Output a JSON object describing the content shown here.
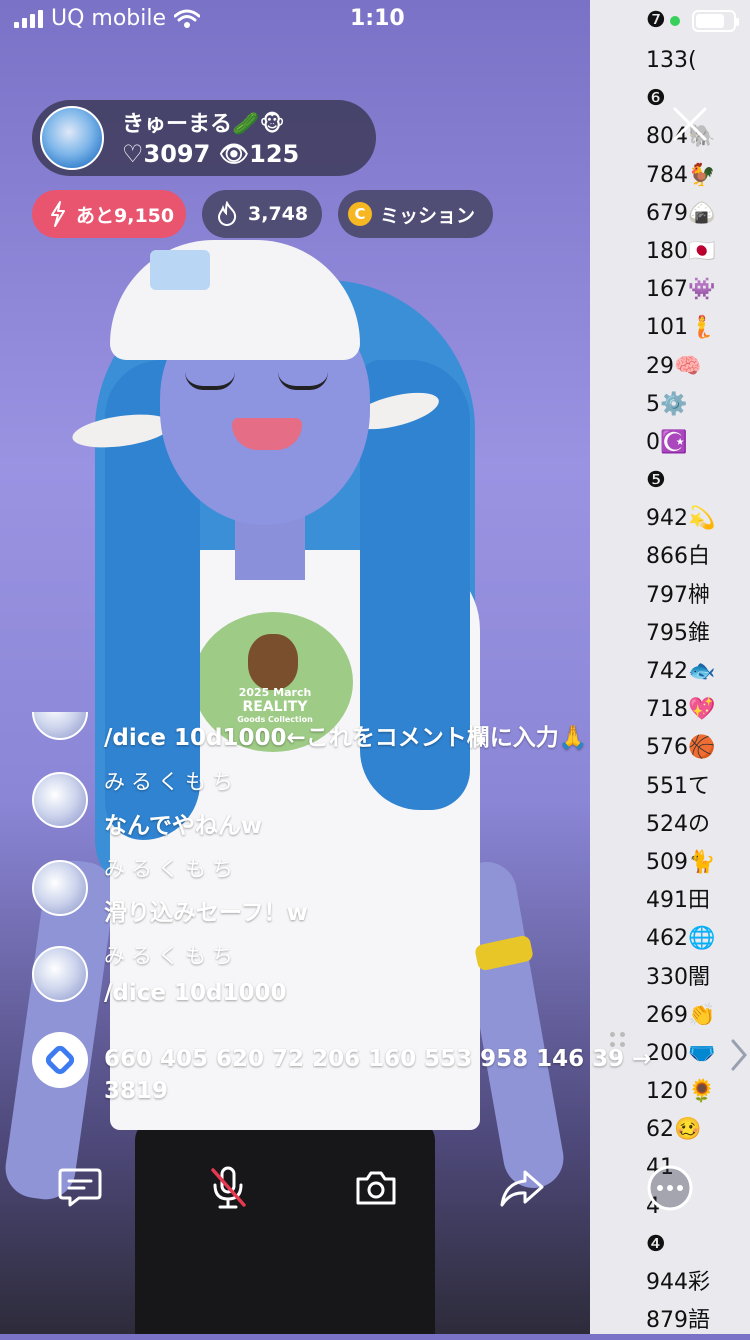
{
  "status_bar": {
    "carrier": "UQ mobile",
    "time": "1:10"
  },
  "streamer": {
    "name": "きゅーまる🥒🐵",
    "stats": "♡3097 👁125"
  },
  "pills": {
    "boost": "あと9,150",
    "fire": "3,748",
    "mission_coin": "C",
    "mission": "ミッション"
  },
  "comments": {
    "partial": "/dice 10d1000←これをコメント欄に入力🙏",
    "items": [
      {
        "name": "みるくもち",
        "text": "なんでやねんw"
      },
      {
        "name": "みるくもち",
        "text": "滑り込みセーフ！w"
      },
      {
        "name": "みるくもち",
        "text": "/dice 10d1000"
      }
    ],
    "dice_result_line1": "660 405 620 72 206 160 553 958 146 39 →",
    "dice_result_line2": "3819"
  },
  "shirt_print": {
    "line1": "2025 March",
    "line2": "REALITY",
    "line3": "Goods Collection"
  },
  "side_panel": {
    "top": "❼",
    "items": [
      "133(",
      "❻",
      "804🐘",
      "784🐓",
      "679🍙",
      "180🇯🇵",
      "167👾",
      "101🧜",
      "29🧠",
      "5⚙️",
      "0☪️",
      "❺",
      "942💫",
      "866白",
      "797榊",
      "795錐",
      "742🐟",
      "718💖",
      "576🏀",
      "551て",
      "524の",
      "509🐈",
      "491田",
      "462🌐",
      "330闇",
      "269👏",
      "200🩲",
      "120🌻",
      "62🥴",
      "41",
      "4",
      "❹",
      "944彩",
      "879語"
    ]
  }
}
